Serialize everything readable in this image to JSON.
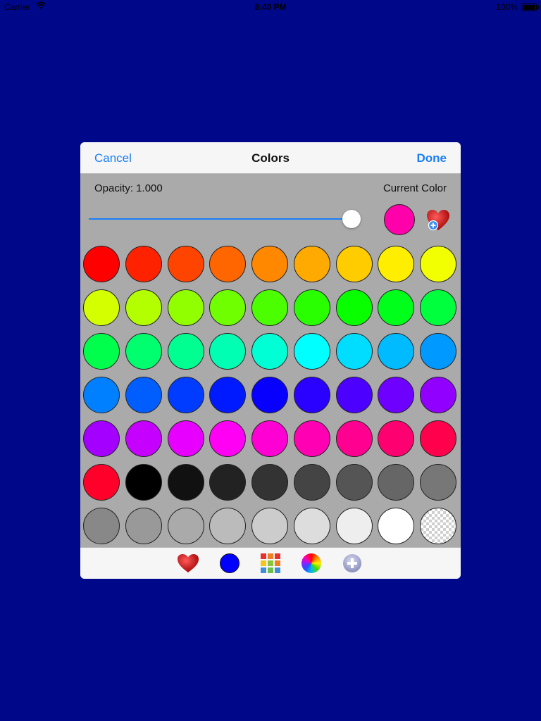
{
  "status_bar": {
    "carrier": "Carrier",
    "time": "8:40 PM",
    "battery": "100%",
    "icons": [
      "wifi-icon",
      "battery-icon"
    ]
  },
  "navbar": {
    "cancel_label": "Cancel",
    "title": "Colors",
    "done_label": "Done"
  },
  "controls": {
    "opacity_label": "Opacity: 1.000",
    "opacity_value": 1.0,
    "current_color_label": "Current Color",
    "current_color": "#ff00aa",
    "favorite_add_icon": "heart-add-icon"
  },
  "palette": [
    [
      "#ff0000",
      "#ff2200",
      "#ff4400",
      "#ff6600",
      "#ff8800",
      "#ffaa00",
      "#ffcc00",
      "#ffee00",
      "#f2ff00"
    ],
    [
      "#d4ff00",
      "#b3ff00",
      "#91ff00",
      "#70ff00",
      "#4cff00",
      "#2aff00",
      "#08ff00",
      "#00ff1a",
      "#00ff3c"
    ],
    [
      "#00ff4c",
      "#00ff6e",
      "#00ff91",
      "#00ffb3",
      "#00ffd5",
      "#00ffff",
      "#00ddff",
      "#00bbff",
      "#0099ff"
    ],
    [
      "#0080ff",
      "#005eff",
      "#003cff",
      "#001aff",
      "#0800ff",
      "#2a00ff",
      "#4c00ff",
      "#6e00ff",
      "#9100ff"
    ],
    [
      "#a300ff",
      "#c500ff",
      "#e700ff",
      "#ff00f5",
      "#ff00d4",
      "#ff00b3",
      "#ff0091",
      "#ff0070",
      "#ff004c"
    ],
    [
      "#ff002a",
      "#000000",
      "#111111",
      "#222222",
      "#333333",
      "#444444",
      "#555555",
      "#666666",
      "#777777"
    ],
    [
      "#888888",
      "#999999",
      "#aaaaaa",
      "#bbbbbb",
      "#cccccc",
      "#dddddd",
      "#eeeeee",
      "#ffffff",
      "clear"
    ]
  ],
  "tabs": [
    {
      "icon": "heart-icon",
      "name": "tab-favorites"
    },
    {
      "icon": "color-dot-icon",
      "name": "tab-current",
      "color": "#0000ff"
    },
    {
      "icon": "color-grid-icon",
      "name": "tab-palette"
    },
    {
      "icon": "color-wheel-icon",
      "name": "tab-wheel"
    },
    {
      "icon": "plus-circle-icon",
      "name": "tab-add"
    }
  ],
  "colors": {
    "background": "#00088a",
    "accent": "#1a7ef5",
    "panel": "#aaaaaa",
    "bar": "#f6f6f7"
  }
}
